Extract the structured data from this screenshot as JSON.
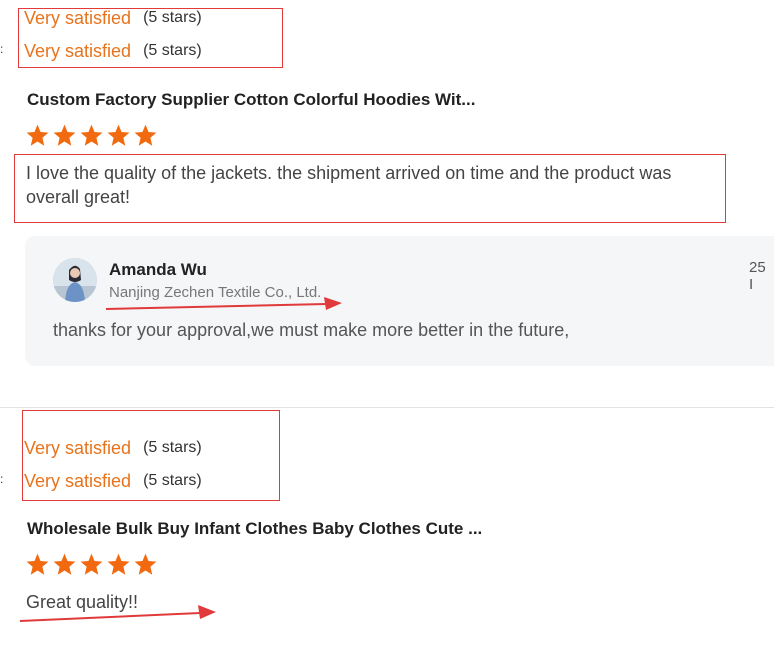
{
  "review1": {
    "satisfaction": [
      {
        "label": "Very satisfied",
        "stars_text": "(5 stars)"
      },
      {
        "label": "Very satisfied",
        "stars_text": "(5 stars)"
      }
    ],
    "edge_marks": [
      ":",
      ":"
    ],
    "product_title": "Custom Factory Supplier Cotton Colorful Hoodies Wit...",
    "rating": 5,
    "text": "I love the quality of the jackets. the shipment arrived on time and the product was overall great!",
    "reply": {
      "name": "Amanda Wu",
      "company": "Nanjing Zechen Textile Co., Ltd.",
      "date": "25 I",
      "text": "thanks for your approval,we must make more better in the future,"
    }
  },
  "review2": {
    "satisfaction": [
      {
        "label": "Very satisfied",
        "stars_text": "(5 stars)"
      },
      {
        "label": "Very satisfied",
        "stars_text": "(5 stars)"
      }
    ],
    "edge_marks": [
      ":",
      ":"
    ],
    "product_title": "Wholesale Bulk Buy Infant Clothes Baby Clothes Cute ...",
    "rating": 5,
    "text": "Great quality!!"
  },
  "colors": {
    "accent": "#e8731c",
    "star": "#f26a10",
    "annotation": "#e03a3a",
    "reply_bg": "#f5f6f8"
  }
}
